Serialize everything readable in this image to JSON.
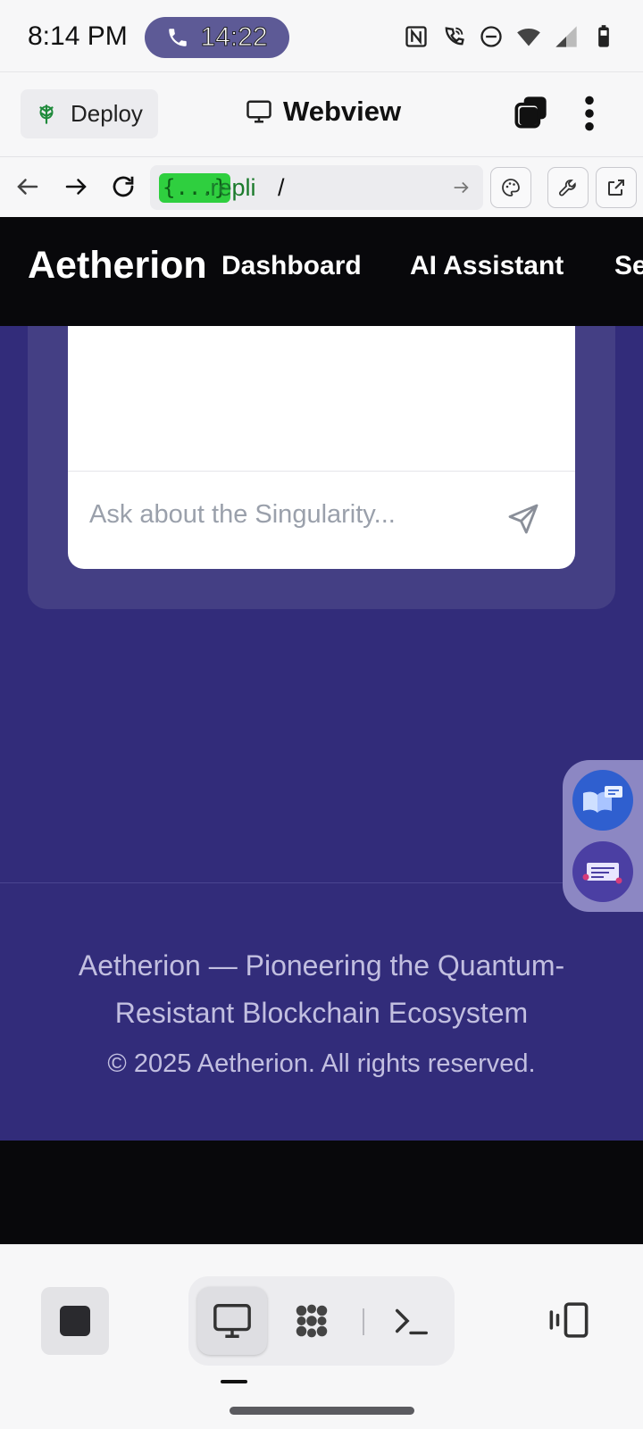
{
  "status_bar": {
    "time": "8:14 PM",
    "call_timer": "14:22",
    "icons": [
      "nfc-icon",
      "wifi-calling-icon",
      "do-not-disturb-icon",
      "wifi-icon",
      "signal-icon",
      "battery-icon"
    ]
  },
  "app_bar": {
    "deploy_label": "Deploy",
    "title": "Webview"
  },
  "url_bar": {
    "badge": "{...}",
    "host": ".repli",
    "path": "/"
  },
  "site_nav": {
    "brand": "Aetherion",
    "links": [
      "Dashboard",
      "AI Assistant",
      "Se"
    ]
  },
  "chat": {
    "placeholder": "Ask about the Singularity..."
  },
  "footer": {
    "tagline": "Aetherion — Pioneering the Quantum-Resistant Blockchain Ecosystem",
    "copyright": "© 2025 Aetherion. All rights reserved."
  },
  "colors": {
    "page_background": "#322c7a",
    "panel": "#443f84",
    "nav_background": "#08080b",
    "url_badge": "#2fcf3f",
    "call_pill": "#5d5a96"
  }
}
